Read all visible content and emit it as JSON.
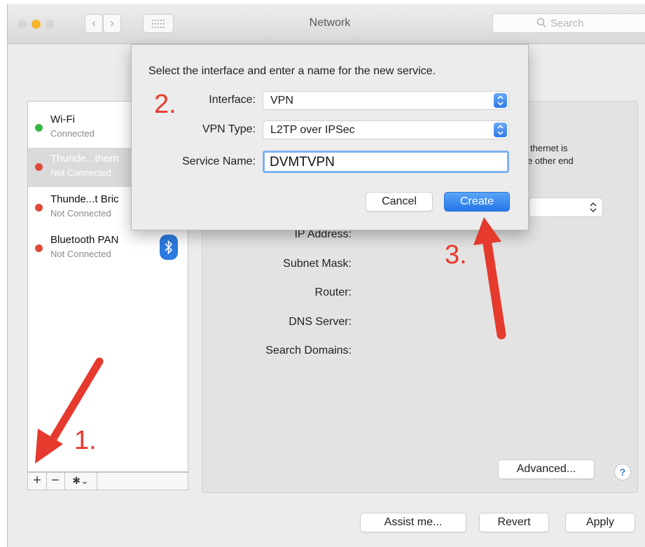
{
  "window": {
    "title": "Network"
  },
  "toolbar": {
    "search_placeholder": "Search",
    "back_glyph": "‹",
    "forward_glyph": "›"
  },
  "services": [
    {
      "name": "Wi-Fi",
      "status": "Connected",
      "status_color": "#35b843",
      "selected": false
    },
    {
      "name": "Thunde...thern",
      "status": "Not Connected",
      "status_color": "#e0483d",
      "selected": true
    },
    {
      "name": "Thunde...t Bric",
      "status": "Not Connected",
      "status_color": "#e0483d",
      "selected": false
    },
    {
      "name": "Bluetooth PAN",
      "status": "Not Connected",
      "status_color": "#e0483d",
      "selected": false,
      "icon": "bluetooth-icon"
    }
  ],
  "sidebar_tools": {
    "add": "+",
    "remove": "−",
    "action": "✱⌄"
  },
  "detail": {
    "partial_line1": "thernet is",
    "partial_line2": "e other end",
    "labels": [
      "IP Address:",
      "Subnet Mask:",
      "Router:",
      "DNS Server:",
      "Search Domains:"
    ],
    "advanced_button": "Advanced...",
    "help_glyph": "?"
  },
  "footer": {
    "assist_button": "Assist me...",
    "revert_button": "Revert",
    "apply_button": "Apply"
  },
  "sheet": {
    "prompt": "Select the interface and enter a name for the new service.",
    "interface_label": "Interface:",
    "interface_value": "VPN",
    "vpn_type_label": "VPN Type:",
    "vpn_type_value": "L2TP over IPSec",
    "service_name_label": "Service Name:",
    "service_name_value": "DVMTVPN",
    "cancel_button": "Cancel",
    "create_button": "Create"
  },
  "annotations": {
    "step1": "1.",
    "step2": "2.",
    "step3": "3.",
    "color": "#e63a2e"
  },
  "colors": {
    "accent": "#2a7be8",
    "connected": "#35b843",
    "not_connected": "#e0483d"
  }
}
